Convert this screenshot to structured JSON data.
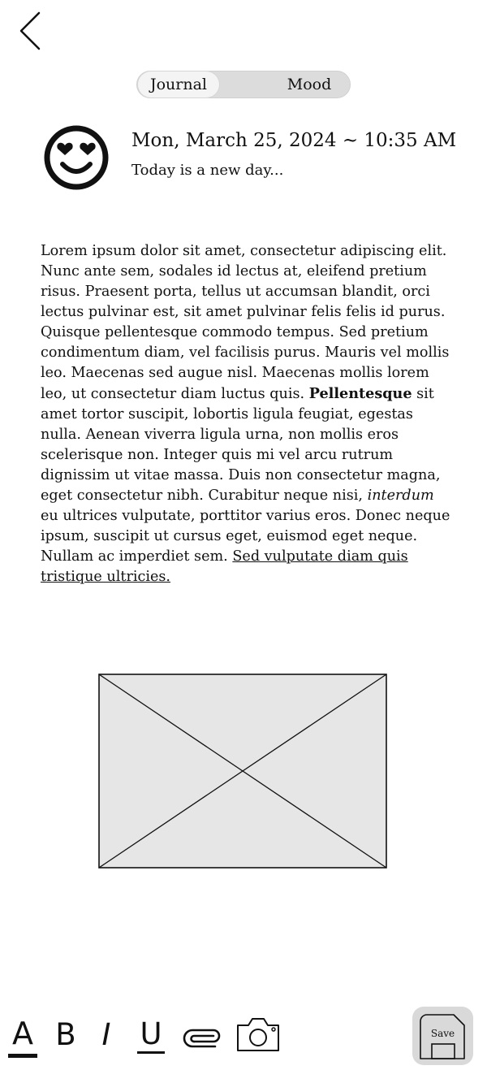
{
  "header": {
    "back_icon": "chevron-left-icon"
  },
  "tabs": [
    {
      "label": "Journal",
      "active": true
    },
    {
      "label": "Mood",
      "active": false
    }
  ],
  "entry": {
    "mood_icon": "heart-eyes-smiley-icon",
    "date_time": "Mon, March 25, 2024 ~ 10:35 AM",
    "subtitle": "Today is a new day...",
    "body": {
      "text_1": "Lorem ipsum dolor sit amet, consectetur adipiscing elit. Nunc ante sem, sodales id lectus at, eleifend pretium risus. Praesent porta, tellus ut accumsan blandit, orci lectus pulvinar est, sit amet pulvinar felis felis id purus. Quisque pellentesque commodo tempus. Sed pretium condimentum diam, vel facilisis purus. Mauris vel mollis leo. Maecenas sed augue nisl. Maecenas mollis lorem leo, ut consectetur diam luctus quis. ",
      "bold": "Pellentesque",
      "text_2": " sit amet tortor suscipit, lobortis ligula feugiat, egestas nulla. Aenean viverra ligula urna, non mollis eros scelerisque non. Integer quis mi vel arcu rutrum dignissim ut vitae massa. Duis non consectetur magna, eget consectetur nibh. Curabitur neque nisi, ",
      "italic": "interdum",
      "text_3": " eu ultrices vulputate, porttitor varius eros. Donec neque ipsum, suscipit ut cursus eget, euismod eget neque. Nullam ac imperdiet sem. ",
      "underlined": "Sed vulputate diam quis tristique ultricies."
    },
    "image_placeholder": "image-placeholder-icon"
  },
  "toolbar": {
    "text_color_label": "A",
    "bold_label": "B",
    "italic_label": "I",
    "underline_label": "U",
    "attach_icon": "paperclip-icon",
    "camera_icon": "camera-icon",
    "save_label": "Save",
    "save_icon": "floppy-disk-icon"
  },
  "colors": {
    "background": "#ffffff",
    "text": "#111111",
    "segmented_track": "#dcdcdc",
    "segmented_active": "#f4f4f4",
    "placeholder_fill": "#e6e6e6",
    "save_button_bg": "#d9d9d9"
  }
}
